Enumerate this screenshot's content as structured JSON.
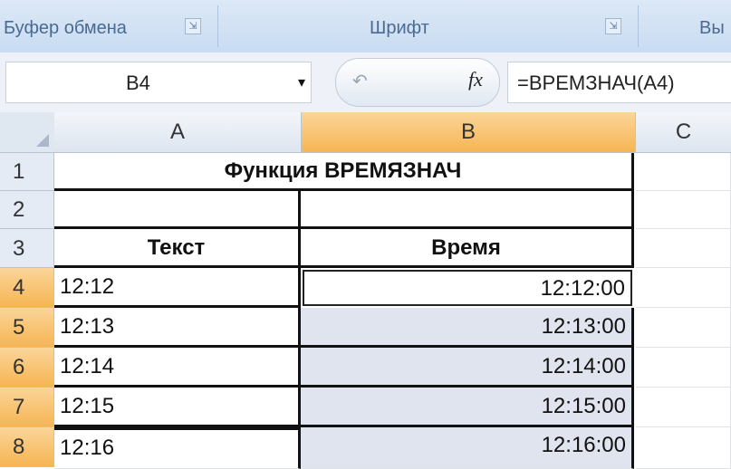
{
  "ribbon": {
    "groups": [
      {
        "label": "Буфер обмена",
        "launcher": "⇲"
      },
      {
        "label": "Шрифт",
        "launcher": "⇲"
      },
      {
        "label": "Вы"
      }
    ]
  },
  "formula_bar": {
    "name_box": "B4",
    "dropdown_icon": "▾",
    "cancel_icon": "↶",
    "fx_label": "fx",
    "formula": "=ВРЕМЗНАЧ(A4)"
  },
  "sheet": {
    "columns": [
      "A",
      "B",
      "C"
    ],
    "selected_column": "B",
    "rows": [
      "1",
      "2",
      "3",
      "4",
      "5",
      "6",
      "7",
      "8"
    ],
    "selected_rows": [
      "4",
      "5",
      "6",
      "7",
      "8"
    ],
    "title": "Функция ВРЕМЯЗНАЧ",
    "header_text": "Текст",
    "header_time": "Время",
    "data": [
      {
        "text": "12:12",
        "time": "12:12:00"
      },
      {
        "text": "12:13",
        "time": "12:13:00"
      },
      {
        "text": "12:14",
        "time": "12:14:00"
      },
      {
        "text": "12:15",
        "time": "12:15:00"
      },
      {
        "text": "12:16",
        "time": "12:16:00"
      }
    ]
  },
  "colors": {
    "selection_header": "#f6b552",
    "ribbon": "#c9dcf2"
  }
}
